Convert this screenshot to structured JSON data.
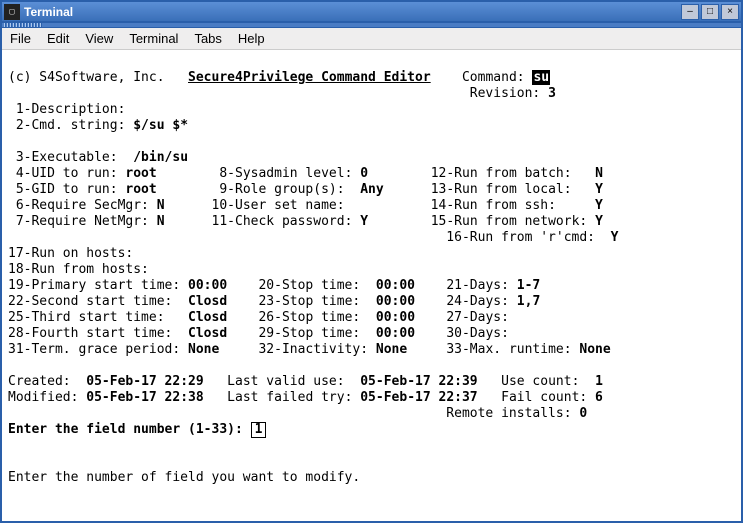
{
  "window": {
    "title": "Terminal"
  },
  "menu": {
    "file": "File",
    "edit": "Edit",
    "view": "View",
    "terminal": "Terminal",
    "tabs": "Tabs",
    "help": "Help"
  },
  "hdr": {
    "copy": "(c) S4Software, Inc.",
    "appTitle": "Secure4Privilege Command Editor",
    "cmdLbl": "Command:",
    "cmdVal": "su",
    "revLbl": "Revision:",
    "revVal": "3"
  },
  "f1": {
    "l": "1-Description:",
    "v": ""
  },
  "f2": {
    "l": "2-Cmd. string:",
    "v": "$/su $*"
  },
  "f3": {
    "l": "3-Executable:",
    "v": "/bin/su"
  },
  "f4": {
    "l": "4-UID to run:",
    "v": "root"
  },
  "f5": {
    "l": "5-GID to run:",
    "v": "root"
  },
  "f6": {
    "l": "6-Require SecMgr:",
    "v": "N"
  },
  "f7": {
    "l": "7-Require NetMgr:",
    "v": "N"
  },
  "f8": {
    "l": "8-Sysadmin level:",
    "v": "0"
  },
  "f9": {
    "l": "9-Role group(s):",
    "v": "Any"
  },
  "f10": {
    "l": "10-User set name:",
    "v": ""
  },
  "f11": {
    "l": "11-Check password:",
    "v": "Y"
  },
  "f12": {
    "l": "12-Run from batch:",
    "v": "N"
  },
  "f13": {
    "l": "13-Run from local:",
    "v": "Y"
  },
  "f14": {
    "l": "14-Run from ssh:",
    "v": "Y"
  },
  "f15": {
    "l": "15-Run from network:",
    "v": "Y"
  },
  "f16": {
    "l": "16-Run from 'r'cmd:",
    "v": "Y"
  },
  "f17": {
    "l": "17-Run on hosts:"
  },
  "f18": {
    "l": "18-Run from hosts:"
  },
  "f19": {
    "l": "19-Primary start time:",
    "v": "00:00"
  },
  "f20": {
    "l": "20-Stop time:",
    "v": "00:00"
  },
  "f21": {
    "l": "21-Days:",
    "v": "1-7"
  },
  "f22": {
    "l": "22-Second start time:",
    "v": "Closd"
  },
  "f23": {
    "l": "23-Stop time:",
    "v": "00:00"
  },
  "f24": {
    "l": "24-Days:",
    "v": "1,7"
  },
  "f25": {
    "l": "25-Third start time:",
    "v": "Closd"
  },
  "f26": {
    "l": "26-Stop time:",
    "v": "00:00"
  },
  "f27": {
    "l": "27-Days:",
    "v": ""
  },
  "f28": {
    "l": "28-Fourth start time:",
    "v": "Closd"
  },
  "f29": {
    "l": "29-Stop time:",
    "v": "00:00"
  },
  "f30": {
    "l": "30-Days:",
    "v": ""
  },
  "f31": {
    "l": "31-Term. grace period:",
    "v": "None"
  },
  "f32": {
    "l": "32-Inactivity:",
    "v": "None"
  },
  "f33": {
    "l": "33-Max. runtime:",
    "v": "None"
  },
  "foot": {
    "createdL": "Created:",
    "createdV": "05-Feb-17 22:29",
    "modifiedL": "Modified:",
    "modifiedV": "05-Feb-17 22:38",
    "lastValidL": "Last valid use:",
    "lastValidV": "05-Feb-17 22:39",
    "lastFailL": "Last failed try:",
    "lastFailV": "05-Feb-17 22:37",
    "useCountL": "Use count:",
    "useCountV": "1",
    "failCountL": "Fail count:",
    "failCountV": "6",
    "remoteL": "Remote installs:",
    "remoteV": "0"
  },
  "prompt": {
    "text": "Enter the field number (1-33):",
    "val": "1"
  },
  "hint": "Enter the number of field you want to modify."
}
